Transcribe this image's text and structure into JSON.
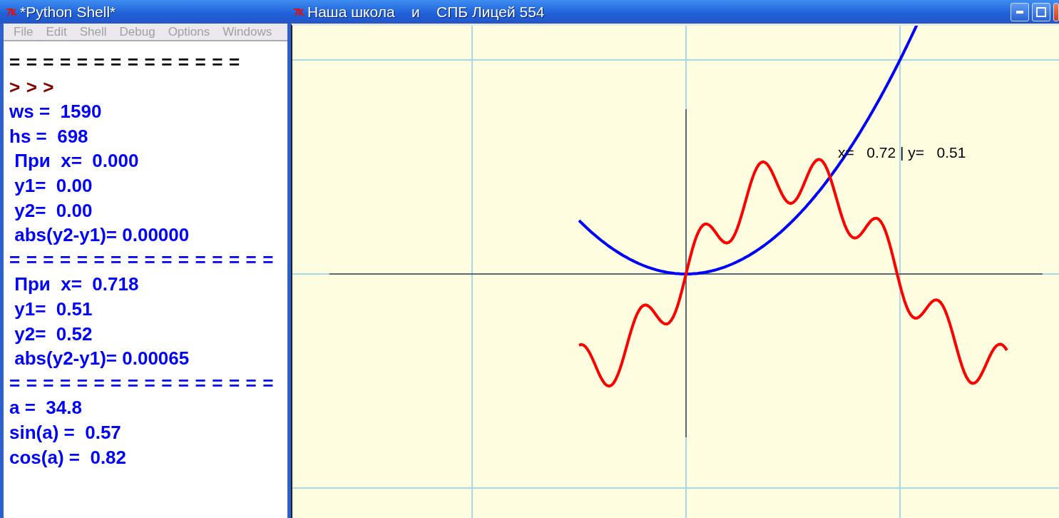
{
  "shell": {
    "title": "*Python Shell*",
    "menu": [
      "File",
      "Edit",
      "Shell",
      "Debug",
      "Options",
      "Windows"
    ],
    "lines": [
      {
        "kind": "separator",
        "text": "==============",
        "color": "#000000"
      },
      {
        "kind": "separator",
        "text": ">>>",
        "color": "#800000"
      },
      {
        "kind": "output",
        "text": "ws =  1590",
        "color": "#0000ff"
      },
      {
        "kind": "output",
        "text": "hs =  698",
        "color": "#0000ff"
      },
      {
        "kind": "output",
        "text": " При  x=  0.000",
        "color": "#0000ff"
      },
      {
        "kind": "output",
        "text": " y1=  0.00",
        "color": "#0000ff"
      },
      {
        "kind": "output",
        "text": " y2=  0.00",
        "color": "#0000ff"
      },
      {
        "kind": "output",
        "text": " abs(y2-y1)= 0.00000",
        "color": "#0000ff"
      },
      {
        "kind": "separator",
        "text": "================",
        "color": "#0000ff"
      },
      {
        "kind": "output",
        "text": " При  x=  0.718",
        "color": "#0000ff"
      },
      {
        "kind": "output",
        "text": " y1=  0.51",
        "color": "#0000ff"
      },
      {
        "kind": "output",
        "text": " y2=  0.52",
        "color": "#0000ff"
      },
      {
        "kind": "output",
        "text": " abs(y2-y1)= 0.00065",
        "color": "#0000ff"
      },
      {
        "kind": "separator",
        "text": "================",
        "color": "#0000ff"
      },
      {
        "kind": "output",
        "text": "a =  34.8",
        "color": "#0000ff"
      },
      {
        "kind": "output",
        "text": "sin(a) =  0.57",
        "color": "#0000ff"
      },
      {
        "kind": "output",
        "text": "cos(a) =  0.82",
        "color": "#0000ff"
      }
    ]
  },
  "plot_window": {
    "title": "Наша школа    и    СПБ Лицей 554",
    "readout": "x=   0.72 | y=   0.51"
  }
}
